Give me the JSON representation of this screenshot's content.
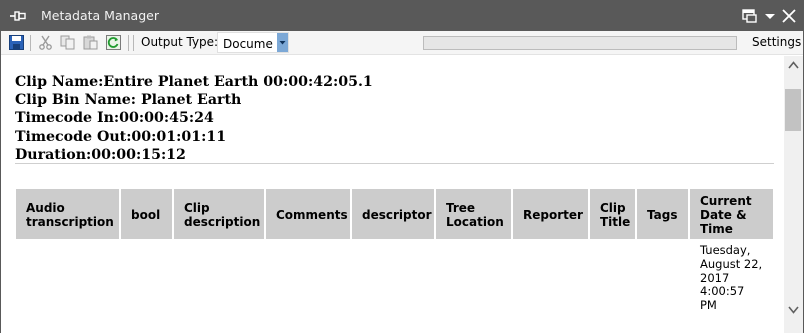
{
  "window": {
    "title": "Metadata Manager"
  },
  "toolbar": {
    "output_type_label": "Output Type:",
    "output_type_value": "Docume",
    "settings_label": "Settings",
    "progress": 0
  },
  "clip_info": {
    "clip_name": "Clip Name:Entire Planet Earth 00:00:42:05.1",
    "clip_bin_name": "Clip Bin Name: Planet Earth",
    "timecode_in": "Timecode In:00:00:45:24",
    "timecode_out": "Timecode Out:00:01:01:11",
    "duration": "Duration:00:00:15:12"
  },
  "table": {
    "headers": [
      {
        "line1": "Audio",
        "line2": "transcription"
      },
      {
        "line1": "bool"
      },
      {
        "line1": "Clip",
        "line2": "description"
      },
      {
        "line1": "Comments"
      },
      {
        "line1": "descriptor"
      },
      {
        "line1": "Tree",
        "line2": "Location"
      },
      {
        "line1": "Reporter"
      },
      {
        "line1": "Clip",
        "line2": "Title"
      },
      {
        "line1": "Tags"
      },
      {
        "line1": "Current",
        "line2": "Date &",
        "line3": "Time"
      }
    ],
    "rows": [
      {
        "current_date_time": [
          "Tuesday,",
          "August 22,",
          "2017",
          "4:00:57",
          "PM"
        ]
      }
    ]
  }
}
